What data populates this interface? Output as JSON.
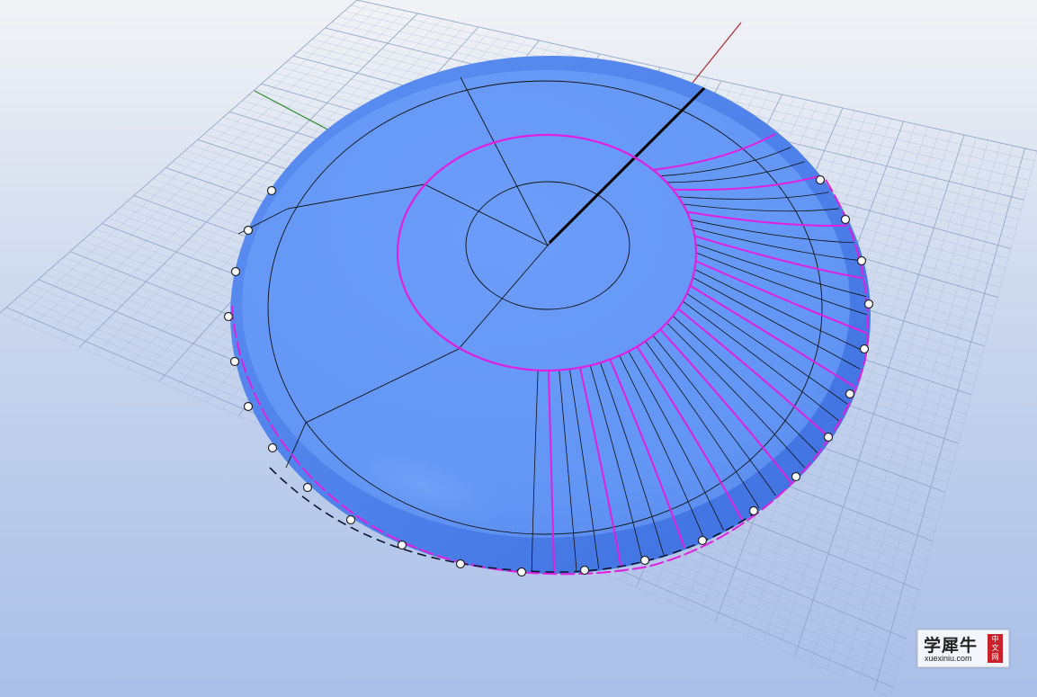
{
  "viewport": {
    "background_top": "#f2f3f6",
    "background_bottom": "#aabfe8",
    "grid_color": "#8fa3c6",
    "x_axis_color": "#b02a2a",
    "y_axis_color": "#2e8b2e",
    "surface_color": "#6a9cf8",
    "highlight_curve_color": "#e21fe0",
    "isocurve_color": "#111111",
    "control_point_color": "#ffffff"
  },
  "watermark": {
    "brand": "学犀牛",
    "url": "xuexiniu.com",
    "seal": [
      "中",
      "文",
      "网"
    ]
  }
}
